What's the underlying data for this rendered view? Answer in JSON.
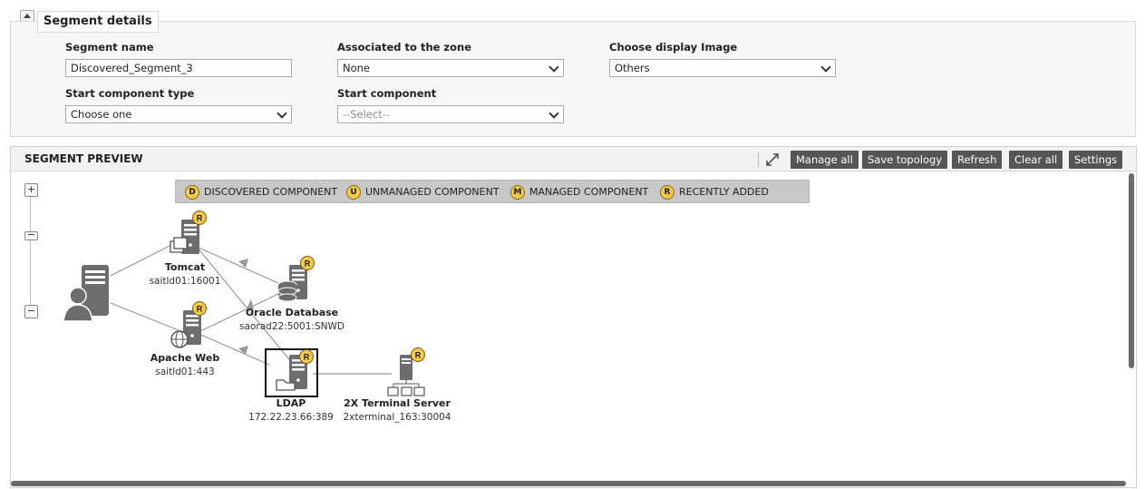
{
  "details": {
    "title": "Segment details",
    "segment_name_label": "Segment name",
    "segment_name_value": "Discovered_Segment_3",
    "zone_label": "Associated to the zone",
    "zone_value": "None",
    "display_image_label": "Choose display Image",
    "display_image_value": "Others",
    "start_type_label": "Start component type",
    "start_type_value": "Choose one",
    "start_component_label": "Start component",
    "start_component_value": "--Select--"
  },
  "preview": {
    "title": "SEGMENT PREVIEW",
    "buttons": [
      "Manage all",
      "Save topology",
      "Refresh",
      "Clear all",
      "Settings"
    ],
    "legend": [
      {
        "badge": "D",
        "label": "DISCOVERED COMPONENT"
      },
      {
        "badge": "U",
        "label": "UNMANAGED COMPONENT"
      },
      {
        "badge": "M",
        "label": "MANAGED COMPONENT"
      },
      {
        "badge": "R",
        "label": "RECENTLY ADDED"
      }
    ],
    "zoom": {
      "plus": "+",
      "minus": "−"
    },
    "nodes": [
      {
        "name": "Tomcat",
        "sub": "saitld01:16001",
        "badge": "R",
        "icon": "tomcat-server-icon"
      },
      {
        "name": "Oracle Database",
        "sub": "saorad22:5001:SNWD",
        "badge": "R",
        "icon": "database-server-icon"
      },
      {
        "name": "Apache Web",
        "sub": "saitld01:443",
        "badge": "R",
        "icon": "web-server-icon"
      },
      {
        "name": "LDAP",
        "sub": "172.22.23.66:389",
        "badge": "R",
        "icon": "ldap-server-icon"
      },
      {
        "name": "2X Terminal Server",
        "sub": "2xterminal_163:30004",
        "badge": "R",
        "icon": "terminal-server-icon"
      }
    ],
    "accent_color": "#f2c94c",
    "button_color": "#555555"
  }
}
